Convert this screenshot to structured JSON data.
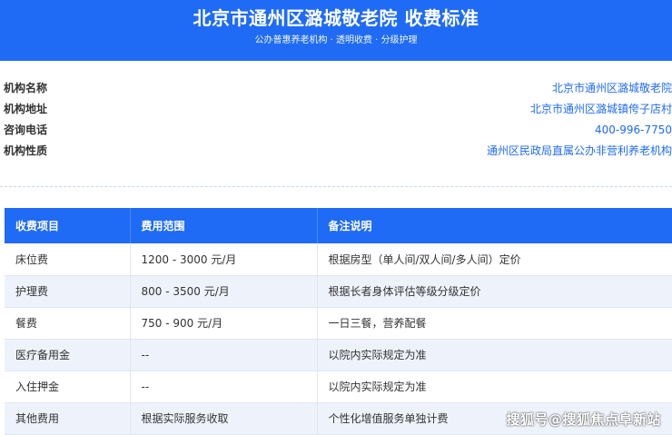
{
  "header": {
    "title": "北京市通州区潞城敬老院 收费标准",
    "subtitle": "公办普惠养老机构 · 透明收费 · 分级护理"
  },
  "info": [
    {
      "label": "机构名称",
      "value": "北京市通州区潞城敬老院"
    },
    {
      "label": "机构地址",
      "value": "北京市通州区潞城镇侉子店村"
    },
    {
      "label": "咨询电话",
      "value": "400-996-7750"
    },
    {
      "label": "机构性质",
      "value": "通州区民政局直属公办非营利养老机构"
    }
  ],
  "table": {
    "headers": [
      "收费项目",
      "费用范围",
      "备注说明"
    ],
    "rows": [
      [
        "床位费",
        "1200 - 3000 元/月",
        "根据房型（单人间/双人间/多人间）定价"
      ],
      [
        "护理费",
        "800 - 3500 元/月",
        "根据长者身体评估等级分级定价"
      ],
      [
        "餐费",
        "750 - 900 元/月",
        "一日三餐，营养配餐"
      ],
      [
        "医疗备用金",
        "--",
        "以院内实际规定为准"
      ],
      [
        "入住押金",
        "--",
        "以院内实际规定为准"
      ],
      [
        "其他费用",
        "根据实际服务收取",
        "个性化增值服务单独计费"
      ]
    ]
  },
  "watermark": "搜狐号@搜狐焦点阜新站",
  "colors": {
    "accent": "#1f6bf5",
    "row_alt": "#eef3fb"
  }
}
